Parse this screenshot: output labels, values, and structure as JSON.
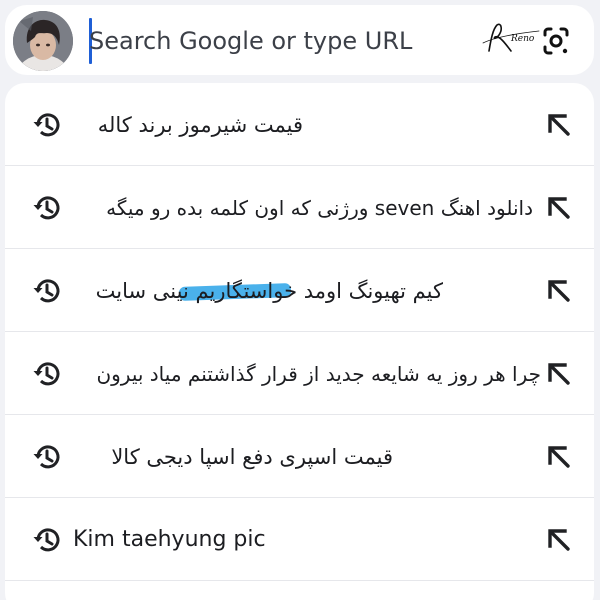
{
  "search": {
    "placeholder": "Search Google or type URL",
    "signature_text": "Reno"
  },
  "icons": {
    "history": "history-clock-icon",
    "fill": "arrow-up-left-icon",
    "lens": "camera-lens-icon"
  },
  "colors": {
    "background": "#f1f2f6",
    "caret": "#1f5fd6",
    "highlight": "#2aa3e8",
    "text": "#1c1d21"
  },
  "suggestions": [
    {
      "text": "قیمت شیرموز برند کاله",
      "dir": "rtl"
    },
    {
      "text": "دانلود اهنگ seven ورژنی که اون کلمه بده رو میگه",
      "dir": "rtl"
    },
    {
      "text": "کیم تهیونگ اومد خواستگاریم نینی سایت",
      "dir": "rtl"
    },
    {
      "text": "چرا هر روز یه شایعه جدید از قرار گذاشتنم میاد بیرون",
      "dir": "rtl"
    },
    {
      "text": "قیمت اسپری دفع اسپا دیجی کالا",
      "dir": "rtl"
    },
    {
      "text": "Kim taehyung pic",
      "dir": "ltr"
    }
  ]
}
